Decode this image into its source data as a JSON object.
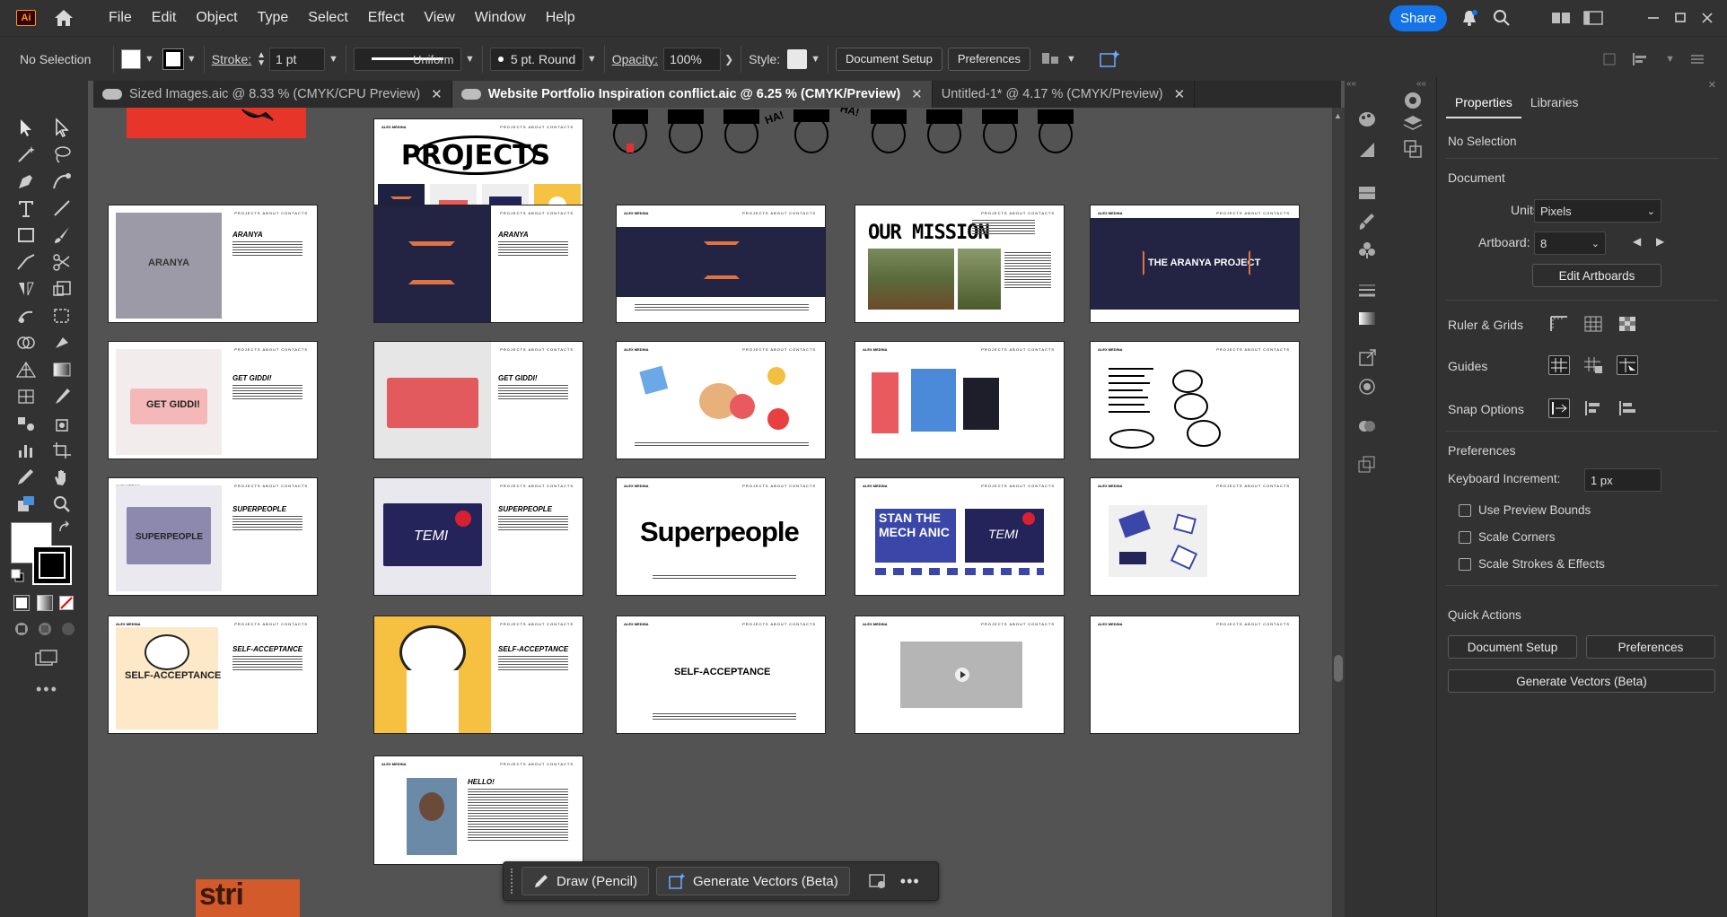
{
  "menubar": {
    "logo": "Ai",
    "menus": [
      "File",
      "Edit",
      "Object",
      "Type",
      "Select",
      "Effect",
      "View",
      "Window",
      "Help"
    ],
    "share_label": "Share"
  },
  "control": {
    "selection": "No Selection",
    "stroke_label": "Stroke:",
    "stroke_value": "1 pt",
    "profile": "Uniform",
    "brush": "5 pt. Round",
    "opacity_label": "Opacity:",
    "opacity_value": "100%",
    "style_label": "Style:",
    "document_setup": "Document Setup",
    "preferences": "Preferences"
  },
  "tabs": [
    {
      "label": "Sized Images.aic @ 8.33 % (CMYK/CPU Preview)",
      "cloud": true,
      "active": false
    },
    {
      "label": "Website Portfolio Inspiration conflict.aic @ 6.25 % (CMYK/Preview)",
      "cloud": true,
      "active": true
    },
    {
      "label": "Untitled-1* @ 4.17 % (CMYK/Preview)",
      "cloud": false,
      "active": false
    }
  ],
  "canvas": {
    "brand": "ALEX MEDINA",
    "nav": "PROJECTS   ABOUT   CONTACTS",
    "projects_title": "PROJECTS",
    "aranya": "ARANYA",
    "our_mission": "OUR MISSION",
    "aranya_project": "THE ARANYA PROJECT",
    "get_giddi": "GET GIDDI!",
    "get_giddi_h": "GET GIDDI!",
    "superpeople_h": "SUPERPEOPLE",
    "superpeople_logo": "Superpeople",
    "superpeople_box": "SUPERPEOPLE",
    "temi": "TEMI",
    "stan": "STAN THE MECH ANIC",
    "self_acceptance": "SELF-ACCEPTANCE",
    "hello": "HELLO!",
    "ha": "HA!"
  },
  "properties": {
    "tab_properties": "Properties",
    "tab_libraries": "Libraries",
    "no_selection": "No Selection",
    "document": "Document",
    "units_label": "Units:",
    "units_value": "Pixels",
    "artboard_label": "Artboard:",
    "artboard_value": "8",
    "edit_artboards": "Edit Artboards",
    "ruler_grids": "Ruler & Grids",
    "guides": "Guides",
    "snap_options": "Snap Options",
    "preferences": "Preferences",
    "keyboard_increment_label": "Keyboard Increment:",
    "keyboard_increment_value": "1 px",
    "use_preview_bounds": "Use Preview Bounds",
    "scale_corners": "Scale Corners",
    "scale_strokes": "Scale Strokes & Effects",
    "quick_actions": "Quick Actions",
    "document_setup": "Document Setup",
    "preferences_btn": "Preferences",
    "generate_vectors": "Generate Vectors (Beta)"
  },
  "contextbar": {
    "draw": "Draw (Pencil)",
    "generate": "Generate Vectors (Beta)"
  }
}
